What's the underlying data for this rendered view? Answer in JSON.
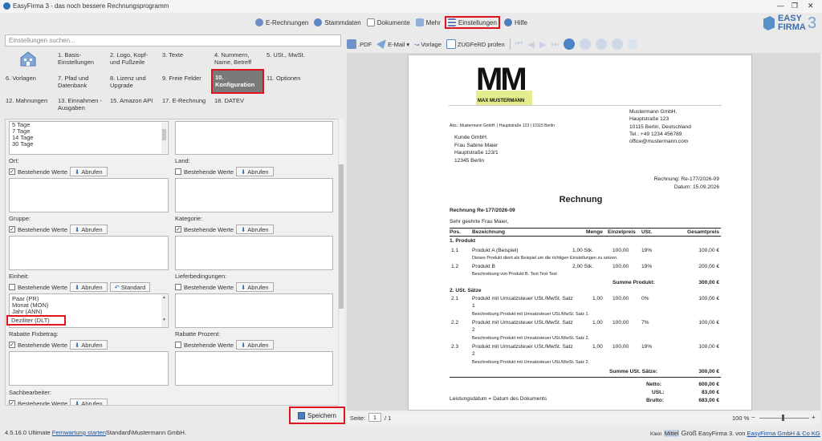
{
  "window": {
    "title": "EasyFirma 3 - das noch bessere Rechnungsprogramm"
  },
  "menu": {
    "erechnungen": "E-Rechnungen",
    "stammdaten": "Stammdaten",
    "dokumente": "Dokumente",
    "mehr": "Mehr",
    "einstellungen": "Einstellungen",
    "hilfe": "Hilfe"
  },
  "logo": {
    "line1": "EASY",
    "line2": "FIRMA",
    "num": "3"
  },
  "settings": {
    "search_placeholder": "Einstellungen suchen...",
    "nav": [
      {
        "label": "1. Basis-Einstellungen"
      },
      {
        "label": "2. Logo, Kopf- und Fußzeile"
      },
      {
        "label": "3. Texte"
      },
      {
        "label": "4. Nummern, Name, Betreff"
      },
      {
        "label": "5. USt., MwSt."
      },
      {
        "label": "6. Vorlagen"
      },
      {
        "label": "7. Pfad und Datenbank"
      },
      {
        "label": "8. Lizenz und Upgrade"
      },
      {
        "label": "9. Freie Felder"
      },
      {
        "label": "10. Konfiguration"
      },
      {
        "label": "11. Optionen"
      },
      {
        "label": "12. Mahnungen"
      },
      {
        "label": "13. Einnahmen - Ausgaben"
      },
      {
        "label": "15. Amazon API"
      },
      {
        "label": "17. E-Rechnung"
      },
      {
        "label": "18. DATEV"
      }
    ],
    "form": {
      "top_list": [
        "5 Tage",
        "7 Tage",
        "14 Tage",
        "30 Tage"
      ],
      "ort": "Ort:",
      "land": "Land:",
      "gruppe": "Gruppe:",
      "kategorie": "Kategorie:",
      "einheit": "Einheit:",
      "lieferbedingungen": "Lieferbedingungen:",
      "rabatte_fix": "Rabatte Fixbetrag:",
      "rabatte_proz": "Rabatte Prozent:",
      "sachbearbeiter": "Sachbearbeiter:",
      "bestehende": "Bestehende Werte",
      "abrufen": "Abrufen",
      "standard": "Standard",
      "einheit_list": [
        "Paar (PR)",
        "Monat (MON)",
        "Jahr (ANN)",
        "Deziliter (DLT)"
      ]
    },
    "save": "Speichern"
  },
  "status": {
    "version": "4.5.16.0 Ultimate",
    "fernwartung": "Fernwartung starten",
    "path": "Standard\\Mustermann GmbH.",
    "klein": "Klein",
    "mittel": "Mittel",
    "gross": "Groß",
    "credit": "EasyFirma 3. von",
    "company": "EasyFirma GmbH & Co KG"
  },
  "toolbar": {
    "pdf": ".PDF",
    "email": "E-Mail",
    "vorlage": "Vorlage",
    "zugferd": "ZUGFeRD prüfen"
  },
  "pagebar": {
    "seite": "Seite:",
    "page": "1",
    "total": "/ 1",
    "zoom": "100 %"
  },
  "invoice": {
    "logo_mm": "MM",
    "logo_name": "MAX MUSTERMANN",
    "sender_line": "Abs.: Mustermann GmbH. | Hauptstraße 123 | 10115 Berlin",
    "company": [
      "Mustermann GmbH.",
      "Hauptstraße 123",
      "10115 Berlin, Deutschland",
      "Tel.: +49 1234 456789",
      "office@mustermann.com"
    ],
    "recipient": [
      "Kunde GmbH.",
      "Frau Sabine Maier",
      "Hauptstraße 123/1",
      "12345 Berlin"
    ],
    "rechnung_nr": "Rechnung: Re-177/2026-09",
    "datum": "Datum: 15.09.2026",
    "title": "Rechnung",
    "subject": "Rechnung Re-177/2026-09",
    "greeting": "Sehr geehrte Frau Maier,",
    "columns": [
      "Pos.",
      "Bezeichnung",
      "Menge",
      "Einzelpreis",
      "USt.",
      "Gesamtpreis"
    ],
    "sec1": "1. Produkt",
    "sec2": "2. USt. Sätze",
    "r11": {
      "pos": "1.1",
      "name": "Produkt A (Beispiel)",
      "menge": "1,00 Stk.",
      "ep": "100,00",
      "ust": "19%",
      "gp": "100,00 €",
      "desc": "Dieses Produkt dient als Beispiel um die richtigen Einstellungen zu setzen."
    },
    "r12": {
      "pos": "1.2",
      "name": "Produkt B",
      "menge": "2,00 Stk.",
      "ep": "100,00",
      "ust": "19%",
      "gp": "200,00 €",
      "desc": "Beschreibung von Produkt B. Text Text Text"
    },
    "sum1_label": "Summe Produkt:",
    "sum1": "300,00 €",
    "r21": {
      "pos": "2.1",
      "name": "Produkt mit Umsatzsteuer USt./MwSt. Satz",
      "n": "1",
      "menge": "1,00",
      "ep": "100,00",
      "ust": "0%",
      "gp": "100,00 €",
      "desc": "Beschreibung Produkt mit Umsatzsteuer USt./MwSt. Satz 1."
    },
    "r22": {
      "pos": "2.2",
      "name": "Produkt mit Umsatzsteuer USt./MwSt. Satz",
      "n": "2",
      "menge": "1,00",
      "ep": "100,00",
      "ust": "7%",
      "gp": "100,00 €",
      "desc": "Beschreibung Produkt mit Umsatzsteuer USt./MwSt. Satz 2."
    },
    "r23": {
      "pos": "2.3",
      "name": "Produkt mit Umsatzsteuer USt./MwSt. Satz",
      "n": "2",
      "menge": "1,00",
      "ep": "100,00",
      "ust": "19%",
      "gp": "100,00 €",
      "desc": "Beschreibung Produkt mit Umsatzsteuer USt./MwSt. Satz 2."
    },
    "sum2_label": "Summe USt. Sätze:",
    "sum2": "300,00 €",
    "leistungsdatum": "Leistungsdatum = Datum des Dokuments",
    "netto_label": "Netto:",
    "netto": "600,00 €",
    "ust_label": "USt.:",
    "ust": "83,00 €",
    "brutto_label": "Brutto:",
    "brutto": "683,00 €"
  }
}
